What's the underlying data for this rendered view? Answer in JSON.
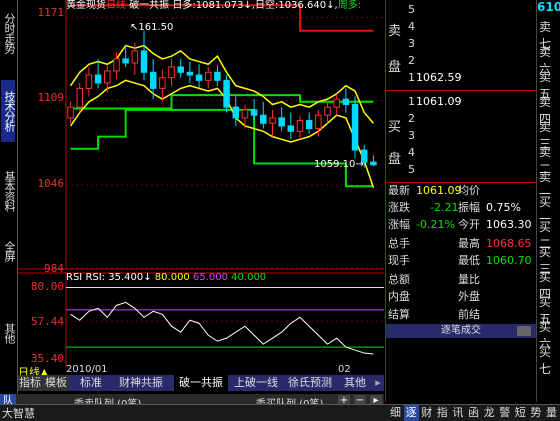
{
  "left_tabs": [
    {
      "label": "分时走势",
      "active": false
    },
    {
      "label": "技术分析",
      "active": true
    },
    {
      "label": "基本资料",
      "active": false
    },
    {
      "label": "全屏",
      "active": false
    },
    {
      "label": "其他",
      "active": false
    }
  ],
  "header": {
    "symbol_name": "黄金现货",
    "period": "日线",
    "indicator": "破一共振",
    "bull_label": "日多:",
    "bull_value": "1081.073↓",
    "bear_label": "日空:",
    "bear_value": "1036.640↓",
    "week_label": "周多:"
  },
  "price_axis": {
    "ticks": [
      "1171",
      "1109",
      "1046",
      "984"
    ]
  },
  "annotations": {
    "high": "161.50",
    "low": "1059.10"
  },
  "date_axis": {
    "labels": [
      "2010/01",
      "02"
    ]
  },
  "rsi": {
    "title": "RSI",
    "value_label": "RSI: 35.400↓",
    "levels": [
      "80.000",
      "65.000",
      "40.000"
    ],
    "ticks": [
      "80.00",
      "57.44",
      "35.40"
    ]
  },
  "period_label": "日线",
  "bottom_tabs": [
    {
      "label": "指标",
      "active": false
    },
    {
      "label": "模板",
      "active": false
    },
    {
      "label": "标准",
      "active": false
    },
    {
      "label": "财神共振",
      "active": false
    },
    {
      "label": "破一共振",
      "active": true
    },
    {
      "label": "上破一线",
      "active": false
    },
    {
      "label": "徐氏预测",
      "active": false
    },
    {
      "label": "其他",
      "active": false
    }
  ],
  "queues": {
    "sell_queue": "委卖队列 (0笔)",
    "buy_queue": "委买队列 (0笔)",
    "corner": "队",
    "brand": "大智慧"
  },
  "order_book": {
    "sell_side_label": "卖盘",
    "buy_side_label": "买盘",
    "sell_levels": [
      "5",
      "4",
      "3",
      "2",
      "1"
    ],
    "buy_levels": [
      "1",
      "2",
      "3",
      "4",
      "5"
    ],
    "sell1_price": "1062.59",
    "buy1_price": "1061.09",
    "right_code_partial": "610"
  },
  "quote": {
    "latest_label": "最新",
    "latest_value": "1061.09",
    "avg_label": "均价",
    "change_label": "涨跌",
    "change_value": "-2.21",
    "amplitude_label": "振幅",
    "amplitude_value": "0.75%",
    "change_pct_label": "涨幅",
    "change_pct_value": "-0.21%",
    "open_label": "今开",
    "open_value": "1063.30",
    "total_vol_label": "总手",
    "high_label": "最高",
    "high_value": "1068.65",
    "current_vol_label": "现手",
    "low_label": "最低",
    "low_value": "1060.70",
    "amount_label": "总额",
    "volume_ratio_label": "量比",
    "inner_label": "内盘",
    "outer_label": "外盘",
    "settle_label": "结算",
    "prev_settle_label": "前结"
  },
  "trade_detail": {
    "title": "逐笔成交"
  },
  "right_col_labels": [
    "卖七",
    "卖六",
    "卖五",
    "卖四",
    "卖三",
    "卖二",
    "卖一",
    "买一",
    "买二",
    "买三",
    "买四",
    "买五",
    "买六",
    "买七"
  ],
  "status_strip": [
    "细",
    "逐",
    "财",
    "指",
    "讯",
    "函",
    "龙",
    "警",
    "短",
    "势",
    "量"
  ],
  "colors": {
    "up": "#ff3030",
    "down": "#00d8ff",
    "band_green": "#00e000",
    "band_yellow": "#ffff00",
    "band_red": "#e01010"
  },
  "candles": [
    {
      "o": 1096,
      "h": 1108,
      "l": 1092,
      "c": 1104
    },
    {
      "o": 1104,
      "h": 1122,
      "l": 1100,
      "c": 1118
    },
    {
      "o": 1118,
      "h": 1134,
      "l": 1112,
      "c": 1128
    },
    {
      "o": 1128,
      "h": 1140,
      "l": 1118,
      "c": 1122
    },
    {
      "o": 1122,
      "h": 1135,
      "l": 1115,
      "c": 1131
    },
    {
      "o": 1131,
      "h": 1145,
      "l": 1125,
      "c": 1140
    },
    {
      "o": 1140,
      "h": 1150,
      "l": 1134,
      "c": 1137
    },
    {
      "o": 1137,
      "h": 1152,
      "l": 1128,
      "c": 1146
    },
    {
      "o": 1146,
      "h": 1161,
      "l": 1124,
      "c": 1130
    },
    {
      "o": 1130,
      "h": 1140,
      "l": 1110,
      "c": 1118
    },
    {
      "o": 1118,
      "h": 1132,
      "l": 1108,
      "c": 1126
    },
    {
      "o": 1126,
      "h": 1140,
      "l": 1120,
      "c": 1134
    },
    {
      "o": 1134,
      "h": 1140,
      "l": 1126,
      "c": 1130
    },
    {
      "o": 1130,
      "h": 1138,
      "l": 1122,
      "c": 1128
    },
    {
      "o": 1128,
      "h": 1136,
      "l": 1118,
      "c": 1124
    },
    {
      "o": 1124,
      "h": 1134,
      "l": 1118,
      "c": 1130
    },
    {
      "o": 1130,
      "h": 1135,
      "l": 1120,
      "c": 1124
    },
    {
      "o": 1124,
      "h": 1128,
      "l": 1100,
      "c": 1104
    },
    {
      "o": 1104,
      "h": 1112,
      "l": 1090,
      "c": 1096
    },
    {
      "o": 1096,
      "h": 1106,
      "l": 1088,
      "c": 1102
    },
    {
      "o": 1102,
      "h": 1110,
      "l": 1094,
      "c": 1098
    },
    {
      "o": 1098,
      "h": 1108,
      "l": 1088,
      "c": 1092
    },
    {
      "o": 1092,
      "h": 1102,
      "l": 1082,
      "c": 1096
    },
    {
      "o": 1096,
      "h": 1104,
      "l": 1086,
      "c": 1090
    },
    {
      "o": 1090,
      "h": 1100,
      "l": 1080,
      "c": 1086
    },
    {
      "o": 1086,
      "h": 1098,
      "l": 1080,
      "c": 1094
    },
    {
      "o": 1094,
      "h": 1100,
      "l": 1084,
      "c": 1088
    },
    {
      "o": 1088,
      "h": 1102,
      "l": 1082,
      "c": 1098
    },
    {
      "o": 1098,
      "h": 1108,
      "l": 1092,
      "c": 1104
    },
    {
      "o": 1104,
      "h": 1114,
      "l": 1098,
      "c": 1110
    },
    {
      "o": 1110,
      "h": 1118,
      "l": 1100,
      "c": 1106
    },
    {
      "o": 1106,
      "h": 1112,
      "l": 1066,
      "c": 1072
    },
    {
      "o": 1072,
      "h": 1076,
      "l": 1059,
      "c": 1063
    },
    {
      "o": 1063,
      "h": 1068,
      "l": 1060,
      "c": 1061
    }
  ],
  "band_upper_green": [
    1103,
    1103,
    1103,
    1103,
    1103,
    1103,
    1103,
    1103,
    1103,
    1103,
    1103,
    1113,
    1113,
    1113,
    1113,
    1113,
    1113,
    1113,
    1113,
    1113,
    1113,
    1113,
    1113,
    1113,
    1113,
    1108,
    1108,
    1108,
    1108,
    1108,
    1108,
    1108,
    1108,
    1108
  ],
  "band_lower_green": [
    1073,
    1073,
    1073,
    1082,
    1082,
    1082,
    1102,
    1102,
    1102,
    1102,
    1102,
    1102,
    1102,
    1102,
    1102,
    1102,
    1102,
    1102,
    1102,
    1102,
    1062,
    1062,
    1062,
    1062,
    1062,
    1062,
    1062,
    1062,
    1062,
    1062,
    1045,
    1045,
    1045,
    1045
  ],
  "band_red": [
    1180,
    1180,
    1180,
    1180,
    1180,
    1180,
    1180,
    1180,
    1180,
    1180,
    1180,
    1180,
    1180,
    1180,
    1180,
    1180,
    1180,
    1180,
    1180,
    1180,
    1180,
    1180,
    1180,
    1180,
    1180,
    1161,
    1161,
    1161,
    1161,
    1161,
    1161,
    1161,
    1161,
    1161
  ],
  "band_yellow_hi": [
    1120,
    1130,
    1136,
    1138,
    1136,
    1140,
    1150,
    1148,
    1150,
    1144,
    1140,
    1142,
    1146,
    1140,
    1138,
    1136,
    1142,
    1130,
    1120,
    1118,
    1116,
    1112,
    1106,
    1108,
    1104,
    1106,
    1104,
    1108,
    1110,
    1114,
    1120,
    1116,
    1100,
    1092
  ],
  "band_yellow_lo": [
    1090,
    1100,
    1108,
    1112,
    1118,
    1120,
    1124,
    1122,
    1120,
    1114,
    1110,
    1114,
    1118,
    1120,
    1118,
    1116,
    1118,
    1110,
    1096,
    1090,
    1088,
    1086,
    1082,
    1080,
    1078,
    1080,
    1082,
    1086,
    1092,
    1098,
    1096,
    1080,
    1064,
    1044
  ],
  "rsi_line": [
    62,
    58,
    64,
    66,
    60,
    68,
    70,
    66,
    60,
    64,
    62,
    54,
    50,
    58,
    56,
    48,
    44,
    46,
    50,
    54,
    48,
    42,
    46,
    50,
    56,
    60,
    54,
    48,
    42,
    46,
    40,
    38,
    36,
    35.4
  ]
}
